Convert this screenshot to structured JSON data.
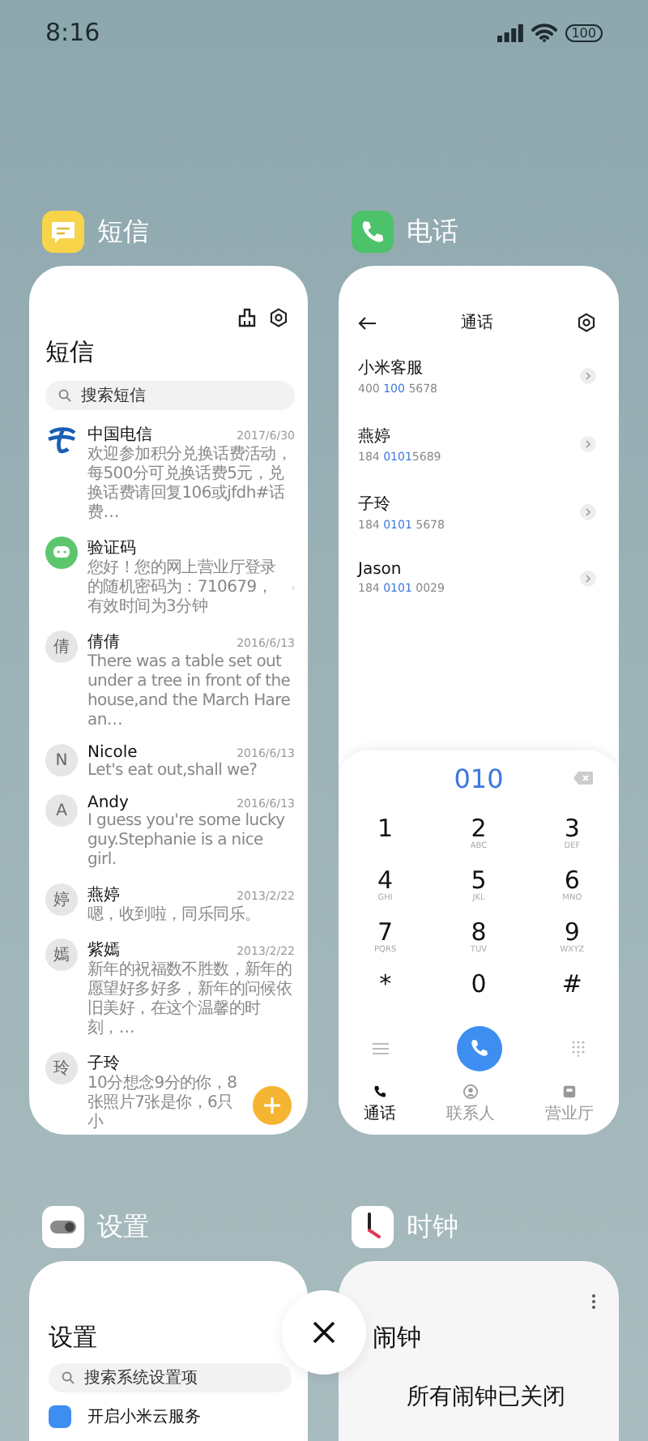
{
  "status_bar": {
    "time": "8:16",
    "battery": "100"
  },
  "apps": [
    {
      "kind": "messages",
      "name": "短信",
      "screen": {
        "title": "短信",
        "search_placeholder": "搜索短信",
        "messages": [
          {
            "kind": "logo",
            "sender": "中国电信",
            "date": "2017/6/30",
            "preview": "欢迎参加积分兑换话费活动，每500分可兑换话费5元，兑换话费请回复106或jfdh#话费…",
            "chevron": false
          },
          {
            "kind": "chat",
            "sender": "验证码",
            "preview": "您好！您的网上营业厅登录的随机密码为：710679，有效时间为3分钟",
            "chevron": true
          },
          {
            "kind": "initial",
            "initial": "倩",
            "sender": "倩倩",
            "date": "2016/6/13",
            "preview": "There was a table set out under a tree in front of the house,and the March Hare an…",
            "chevron": false
          },
          {
            "kind": "initial",
            "initial": "N",
            "sender": "Nicole",
            "date": "2016/6/13",
            "preview": "Let's eat out,shall we?",
            "chevron": false
          },
          {
            "kind": "initial",
            "initial": "A",
            "sender": "Andy",
            "date": "2016/6/13",
            "preview": "I guess you're some lucky guy.Stephanie is a nice girl.",
            "chevron": false
          },
          {
            "kind": "initial",
            "initial": "婷",
            "sender": "燕婷",
            "date": "2013/2/22",
            "preview": "嗯，收到啦，同乐同乐。",
            "chevron": false
          },
          {
            "kind": "initial",
            "initial": "嫣",
            "sender": "紫嫣",
            "date": "2013/2/22",
            "preview": "新年的祝福数不胜数，新年的愿望好多好多，新年的问候依旧美好，在这个温馨的时刻，…",
            "chevron": false
          },
          {
            "kind": "initial",
            "initial": "玲",
            "sender": "子玲",
            "preview": "10分想念9分的你，8张照片7张是你，6只小",
            "chevron": false
          }
        ]
      }
    },
    {
      "kind": "phone",
      "name": "电话",
      "screen": {
        "title": "通话",
        "contacts": [
          {
            "name": "小米客服",
            "number_start": "400 ",
            "number_match": "100",
            "number_end": " 5678"
          },
          {
            "name": "燕婷",
            "number_start": "184 ",
            "number_match": "0101",
            "number_end": "5689"
          },
          {
            "name": "子玲",
            "number_start": "184 ",
            "number_match": "0101",
            "number_end": " 5678"
          },
          {
            "name": "Jason",
            "number_start": "184 ",
            "number_match": "0101",
            "number_end": " 0029"
          }
        ],
        "dialed": "010",
        "keys": [
          {
            "digit": "1"
          },
          {
            "digit": "2",
            "letters": "ABC"
          },
          {
            "digit": "3",
            "letters": "DEF"
          },
          {
            "digit": "4",
            "letters": "GHI"
          },
          {
            "digit": "5",
            "letters": "JKL"
          },
          {
            "digit": "6",
            "letters": "MNO"
          },
          {
            "digit": "7",
            "letters": "PQRS"
          },
          {
            "digit": "8",
            "letters": "TUV"
          },
          {
            "digit": "9",
            "letters": "WXYZ"
          },
          {
            "digit": "*"
          },
          {
            "digit": "0"
          },
          {
            "digit": "#"
          }
        ],
        "tabs": [
          {
            "label": "通话",
            "selected": true
          },
          {
            "label": "联系人",
            "selected": false
          },
          {
            "label": "营业厅",
            "selected": false
          }
        ]
      }
    },
    {
      "kind": "settings",
      "name": "设置",
      "screen": {
        "title": "设置",
        "search_placeholder": "搜索系统设置项",
        "items": [
          "开启小米云服务"
        ]
      }
    },
    {
      "kind": "clock",
      "name": "时钟",
      "screen": {
        "title": "闹钟",
        "message": "所有闹钟已关闭"
      }
    }
  ]
}
